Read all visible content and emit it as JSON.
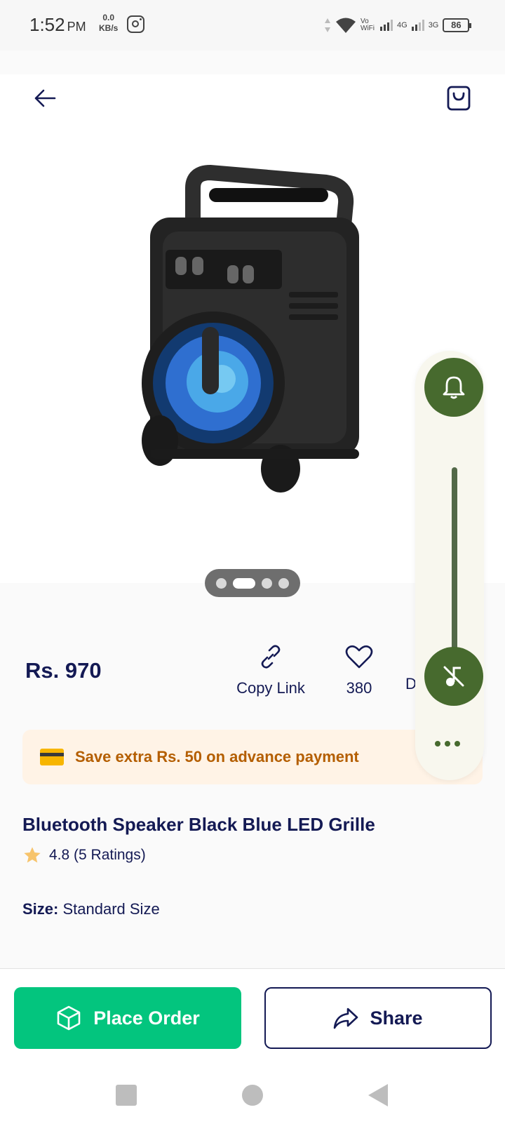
{
  "status_bar": {
    "time": "1:52",
    "ampm": "PM",
    "net_speed": "0.0",
    "net_unit": "KB/s",
    "vowifi": "Vo WiFi",
    "net1": "4G",
    "net2": "3G",
    "battery": "86"
  },
  "product": {
    "price": "Rs. 970",
    "title": "Bluetooth Speaker Black Blue LED Grille",
    "rating": "4.8 (5 Ratings)",
    "size_label": "Size:",
    "size_value": "Standard Size",
    "image_count": 4,
    "active_image": 1
  },
  "actions": {
    "copy_link": "Copy Link",
    "likes": "380",
    "third_partial": "D"
  },
  "banner": {
    "text": "Save extra Rs. 50 on advance payment"
  },
  "bottom": {
    "order_label": "Place Order",
    "share_label": "Share"
  },
  "colors": {
    "primary_green": "#03c57e",
    "navy": "#141a54",
    "banner_bg": "#fff3e6",
    "banner_text": "#b45e00",
    "overlay_green": "#476a2e"
  }
}
